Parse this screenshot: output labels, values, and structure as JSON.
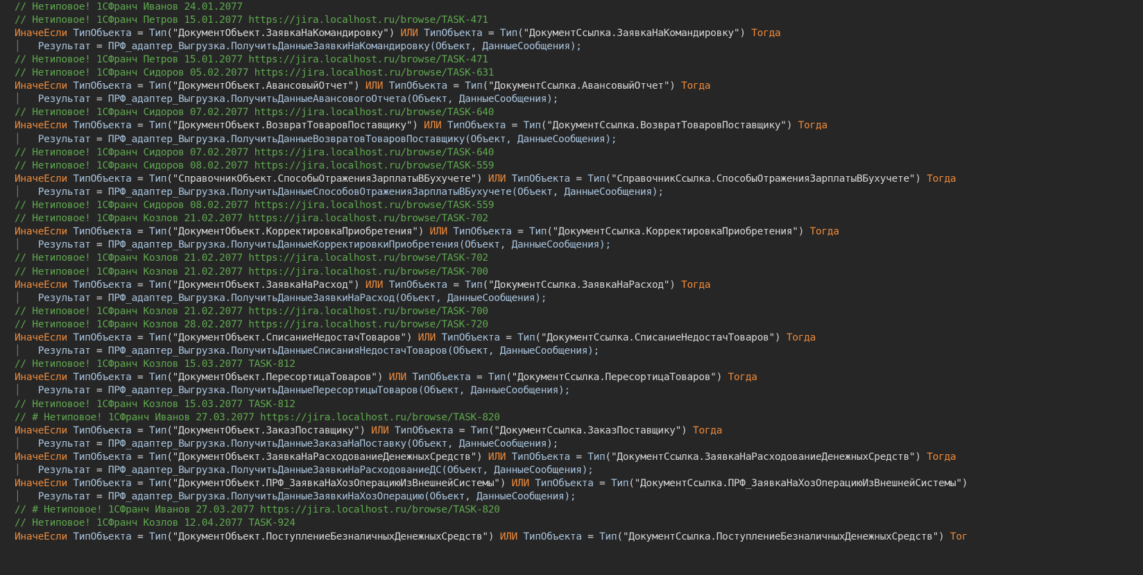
{
  "colors": {
    "background": "#262626",
    "comment": "#5fa84f",
    "keyword": "#ee8a3a",
    "identifier": "#a9c4de",
    "string": "#d8d8d8",
    "operator": "#d0d0d0",
    "indent_guide": "#7a7a7a"
  },
  "lines": [
    {
      "kind": "comment",
      "text": "// Нетиповое! 1СФранч Иванов 24.01.2077"
    },
    {
      "kind": "comment",
      "text": "// Нетиповое! 1СФранч Петров 15.01.2077 https://jira.localhost.ru/browse/TASK-471"
    },
    {
      "kind": "branch",
      "keyword": "ИначеЕсли",
      "var": "ТипОбъекта",
      "left_type": "\"ДокументОбъект.ЗаявкаНаКомандировку\"",
      "or": "ИЛИ",
      "right_type": "\"ДокументСсылка.ЗаявкаНаКомандировку\"",
      "then": "Тогда"
    },
    {
      "kind": "call",
      "result": "Результат",
      "module": "ПРФ_адаптер_Выгрузка.",
      "func": "ПолучитьДанныеЗаявкиНаКомандировку",
      "args": "(Объект, ДанныеСообщения);"
    },
    {
      "kind": "comment",
      "text": "// Нетиповое! 1СФранч Петров 15.01.2077 https://jira.localhost.ru/browse/TASK-471"
    },
    {
      "kind": "comment",
      "text": "// Нетиповое! 1СФранч Сидоров 05.02.2077 https://jira.localhost.ru/browse/TASK-631"
    },
    {
      "kind": "branch",
      "keyword": "ИначеЕсли",
      "var": "ТипОбъекта",
      "left_type": "\"ДокументОбъект.АвансовыйОтчет\"",
      "or": "ИЛИ",
      "right_type": "\"ДокументСсылка.АвансовыйОтчет\"",
      "then": "Тогда"
    },
    {
      "kind": "call",
      "result": "Результат",
      "module": "ПРФ_адаптер_Выгрузка.",
      "func": "ПолучитьДанныеАвансовогоОтчета",
      "args": "(Объект, ДанныеСообщения);"
    },
    {
      "kind": "comment",
      "text": "// Нетиповое! 1СФранч Сидоров 07.02.2077 https://jira.localhost.ru/browse/TASK-640"
    },
    {
      "kind": "branch",
      "keyword": "ИначеЕсли",
      "var": "ТипОбъекта",
      "left_type": "\"ДокументОбъект.ВозвратТоваровПоставщику\"",
      "or": "ИЛИ",
      "right_type": "\"ДокументСсылка.ВозвратТоваровПоставщику\"",
      "then": "Тогда"
    },
    {
      "kind": "call",
      "result": "Результат",
      "module": "ПРФ_адаптер_Выгрузка.",
      "func": "ПолучитьДанныеВозвратовТоваровПоставщику",
      "args": "(Объект, ДанныеСообщения);"
    },
    {
      "kind": "comment",
      "text": "// Нетиповое! 1СФранч Сидоров 07.02.2077 https://jira.localhost.ru/browse/TASK-640"
    },
    {
      "kind": "comment",
      "text": "// Нетиповое! 1СФранч Сидоров 08.02.2077 https://jira.localhost.ru/browse/TASK-559"
    },
    {
      "kind": "branch",
      "keyword": "ИначеЕсли",
      "var": "ТипОбъекта",
      "left_type": "\"СправочникОбъект.СпособыОтраженияЗарплатыВБухучете\"",
      "or": "ИЛИ",
      "right_type": "\"СправочникСсылка.СпособыОтраженияЗарплатыВБухучете\"",
      "then": "Тогда"
    },
    {
      "kind": "call",
      "result": "Результат",
      "module": "ПРФ_адаптер_Выгрузка.",
      "func": "ПолучитьДанныеСпособовОтраженияЗарплатыВБухучете",
      "args": "(Объект, ДанныеСообщения);"
    },
    {
      "kind": "comment",
      "text": "// Нетиповое! 1СФранч Сидоров 08.02.2077 https://jira.localhost.ru/browse/TASK-559"
    },
    {
      "kind": "comment",
      "text": "// Нетиповое! 1СФранч Козлов 21.02.2077 https://jira.localhost.ru/browse/TASK-702"
    },
    {
      "kind": "branch",
      "keyword": "ИначеЕсли",
      "var": "ТипОбъекта",
      "left_type": "\"ДокументОбъект.КорректировкаПриобретения\"",
      "or": "ИЛИ",
      "right_type": "\"ДокументСсылка.КорректировкаПриобретения\"",
      "then": "Тогда"
    },
    {
      "kind": "call",
      "result": "Результат",
      "module": "ПРФ_адаптер_Выгрузка.",
      "func": "ПолучитьДанныеКорректировкиПриобретения",
      "args": "(Объект, ДанныеСообщения);"
    },
    {
      "kind": "comment",
      "text": "// Нетиповое! 1СФранч Козлов 21.02.2077 https://jira.localhost.ru/browse/TASK-702"
    },
    {
      "kind": "comment",
      "text": "// Нетиповое! 1СФранч Козлов 21.02.2077 https://jira.localhost.ru/browse/TASK-700"
    },
    {
      "kind": "branch",
      "keyword": "ИначеЕсли",
      "var": "ТипОбъекта",
      "left_type": "\"ДокументОбъект.ЗаявкаНаРасход\"",
      "or": "ИЛИ",
      "right_type": "\"ДокументСсылка.ЗаявкаНаРасход\"",
      "then": "Тогда"
    },
    {
      "kind": "call",
      "result": "Результат",
      "module": "ПРФ_адаптер_Выгрузка.",
      "func": "ПолучитьДанныеЗаявкиНаРасход",
      "args": "(Объект, ДанныеСообщения);"
    },
    {
      "kind": "comment",
      "text": "// Нетиповое! 1СФранч Козлов 21.02.2077 https://jira.localhost.ru/browse/TASK-700"
    },
    {
      "kind": "comment",
      "text": "// Нетиповое! 1СФранч Козлов 28.02.2077 https://jira.localhost.ru/browse/TASK-720"
    },
    {
      "kind": "branch",
      "keyword": "ИначеЕсли",
      "var": "ТипОбъекта",
      "left_type": "\"ДокументОбъект.СписаниеНедостачТоваров\"",
      "or": "ИЛИ",
      "right_type": "\"ДокументСсылка.СписаниеНедостачТоваров\"",
      "then": "Тогда"
    },
    {
      "kind": "call",
      "result": "Результат",
      "module": "ПРФ_адаптер_Выгрузка.",
      "func": "ПолучитьДанныеСписанияНедостачТоваров",
      "args": "(Объект, ДанныеСообщения);"
    },
    {
      "kind": "comment",
      "text": "// Нетиповое! 1СФранч Козлов 15.03.2077 TASK-812"
    },
    {
      "kind": "branch",
      "keyword": "ИначеЕсли",
      "var": "ТипОбъекта",
      "left_type": "\"ДокументОбъект.ПересортицаТоваров\"",
      "or": "ИЛИ",
      "right_type": "\"ДокументСсылка.ПересортицаТоваров\"",
      "then": "Тогда"
    },
    {
      "kind": "call",
      "result": "Результат",
      "module": "ПРФ_адаптер_Выгрузка.",
      "func": "ПолучитьДанныеПересортицыТоваров",
      "args": "(Объект, ДанныеСообщения);"
    },
    {
      "kind": "comment",
      "text": "// Нетиповое! 1СФранч Козлов 15.03.2077 TASK-812"
    },
    {
      "kind": "comment",
      "text": "// # Нетиповое! 1СФранч Иванов 27.03.2077 https://jira.localhost.ru/browse/TASK-820"
    },
    {
      "kind": "branch",
      "keyword": "ИначеЕсли",
      "var": "ТипОбъекта",
      "left_type": "\"ДокументОбъект.ЗаказПоставщику\"",
      "or": "ИЛИ",
      "right_type": "\"ДокументСсылка.ЗаказПоставщику\"",
      "then": "Тогда"
    },
    {
      "kind": "call",
      "result": "Результат",
      "module": "ПРФ_адаптер_Выгрузка.",
      "func": "ПолучитьДанныеЗаказаНаПоставку",
      "args": "(Объект, ДанныеСообщения);"
    },
    {
      "kind": "branch",
      "keyword": "ИначеЕсли",
      "var": "ТипОбъекта",
      "left_type": "\"ДокументОбъект.ЗаявкаНаРасходованиеДенежныхСредств\"",
      "or": "ИЛИ",
      "right_type": "\"ДокументСсылка.ЗаявкаНаРасходованиеДенежныхСредств\"",
      "then": "Тогда"
    },
    {
      "kind": "call",
      "result": "Результат",
      "module": "ПРФ_адаптер_Выгрузка.",
      "func": "ПолучитьДанныеЗаявкиНаРасходованиеДС",
      "args": "(Объект, ДанныеСообщения);"
    },
    {
      "kind": "branch",
      "keyword": "ИначеЕсли",
      "var": "ТипОбъекта",
      "left_type": "\"ДокументОбъект.ПРФ_ЗаявкаНаХозОперациюИзВнешнейСистемы\"",
      "or": "ИЛИ",
      "right_type": "\"ДокументСсылка.ПРФ_ЗаявкаНаХозОперациюИзВнешнейСистемы\")",
      "then": ""
    },
    {
      "kind": "call",
      "result": "Результат",
      "module": "ПРФ_адаптер_Выгрузка.",
      "func": "ПолучитьДанныеЗаявкиНаХозОперацию",
      "args": "(Объект, ДанныеСообщения);"
    },
    {
      "kind": "comment",
      "text": "// # Нетиповое! 1СФранч Иванов 27.03.2077 https://jira.localhost.ru/browse/TASK-820"
    },
    {
      "kind": "comment",
      "text": "// Нетиповое! 1СФранч Козлов 12.04.2077 TASK-924"
    },
    {
      "kind": "branch",
      "keyword": "ИначеЕсли",
      "var": "ТипОбъекта",
      "left_type": "\"ДокументОбъект.ПоступлениеБезналичныхДенежныхСредств\"",
      "or": "ИЛИ",
      "right_type": "\"ДокументСсылка.ПоступлениеБезналичныхДенежныхСредств\"",
      "then": "Тог"
    }
  ]
}
